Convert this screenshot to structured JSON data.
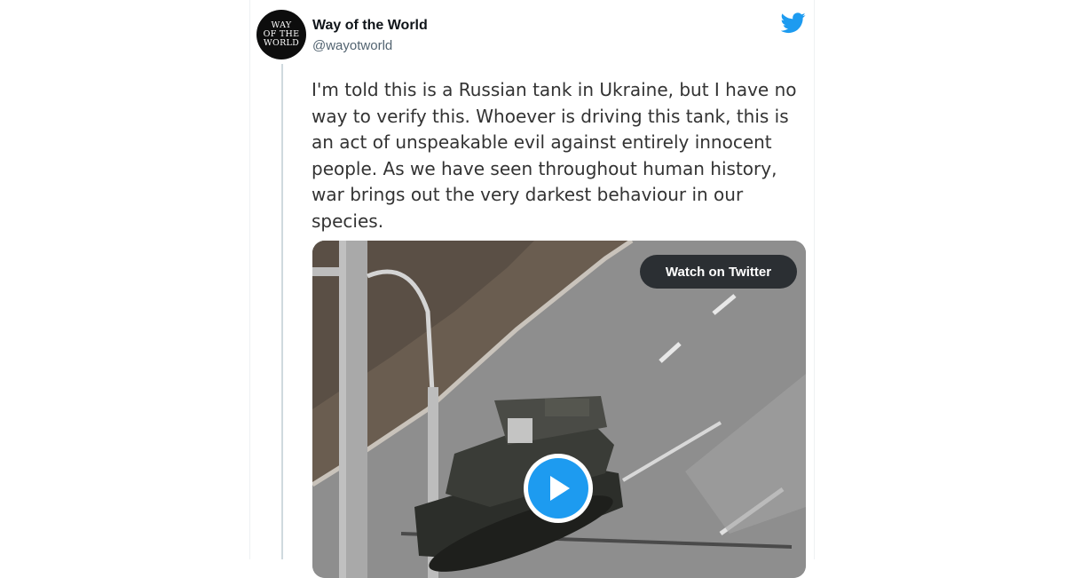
{
  "tweet": {
    "author": {
      "display_name": "Way of the World",
      "handle": "@wayotworld",
      "avatar_text": "WAY\nOF THE\nWORLD"
    },
    "text": "I'm told this is a Russian tank in Ukraine, but I have no way to verify this. Whoever is driving this tank, this is an act of unspeakable evil against entirely innocent people. As we have seen throughout human history, war brings out the very darkest behaviour in our species.",
    "media": {
      "watch_label": "Watch on Twitter",
      "play_icon": "play-icon"
    },
    "brand_icon": "twitter-bird-icon"
  },
  "colors": {
    "brand": "#1d9bf0",
    "name": "#0f1419",
    "handle": "#536471",
    "body_text": "#333333"
  }
}
